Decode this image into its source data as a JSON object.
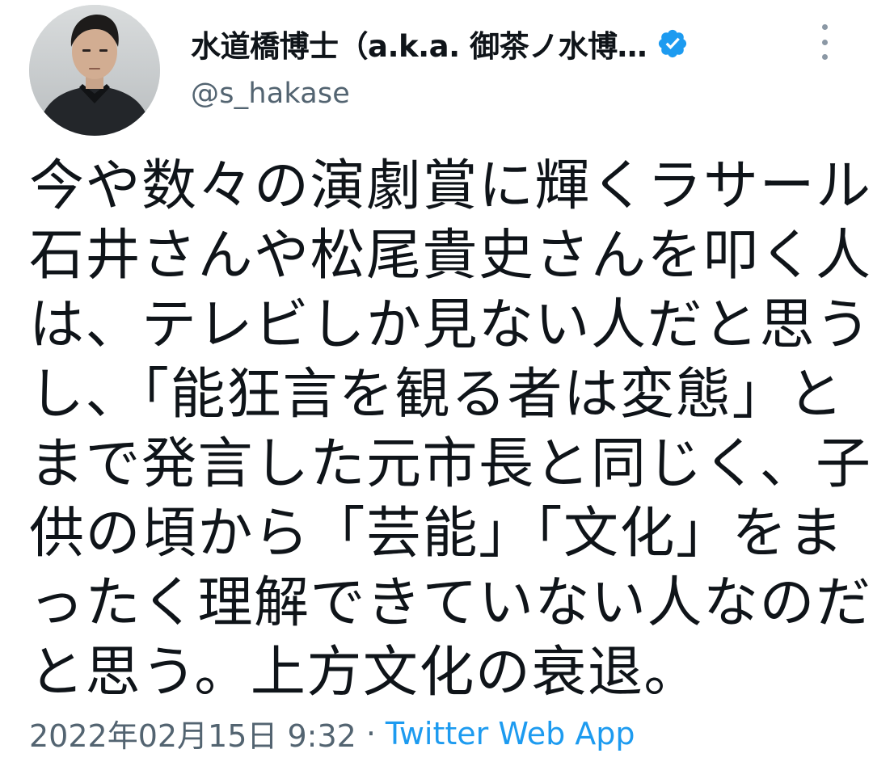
{
  "author": {
    "display_name": "水道橋博士（a.k.a. 御茶ノ水博…",
    "handle": "@s_hakase",
    "verified": true,
    "verified_color": "#1d9bf0"
  },
  "tweet": {
    "text_lines": [
      "今や数々の演劇賞に輝くラサール",
      "石井さんや松尾貴史さんを叩く人",
      "は、テレビしか見ない人だと思う",
      "し、「能狂言を観る者は変態」と",
      "まで発言した元市長と同じく、子",
      "供の頃から「芸能」「文化」をま",
      "ったく理解できていない人なのだ",
      "と思う。上方文化の衰退。"
    ]
  },
  "meta": {
    "timestamp": "2022年02月15日 9:32",
    "separator": "·",
    "source": "Twitter Web App"
  },
  "icons": {
    "verified": "verified-badge-icon",
    "more": "more-vertical-icon"
  }
}
